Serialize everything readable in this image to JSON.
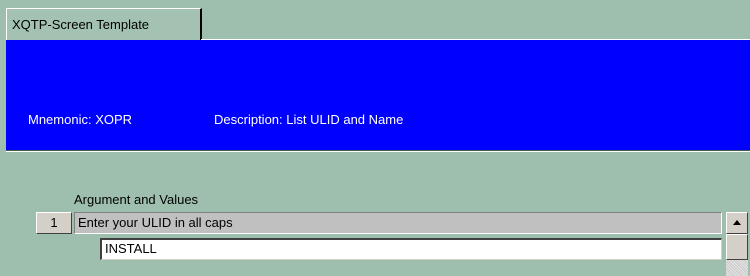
{
  "tab": {
    "label": "XQTP-Screen Template"
  },
  "header": {
    "mnemonic_label": "Mnemonic:",
    "mnemonic_value": "XOPR",
    "description_label": "Description:",
    "description_value": "List ULID and Name",
    "background_color": "#0000ff"
  },
  "arguments": {
    "section_label": "Argument and Values",
    "items": [
      {
        "number": "1",
        "prompt": "Enter your ULID in all caps",
        "value": "INSTALL"
      }
    ]
  }
}
